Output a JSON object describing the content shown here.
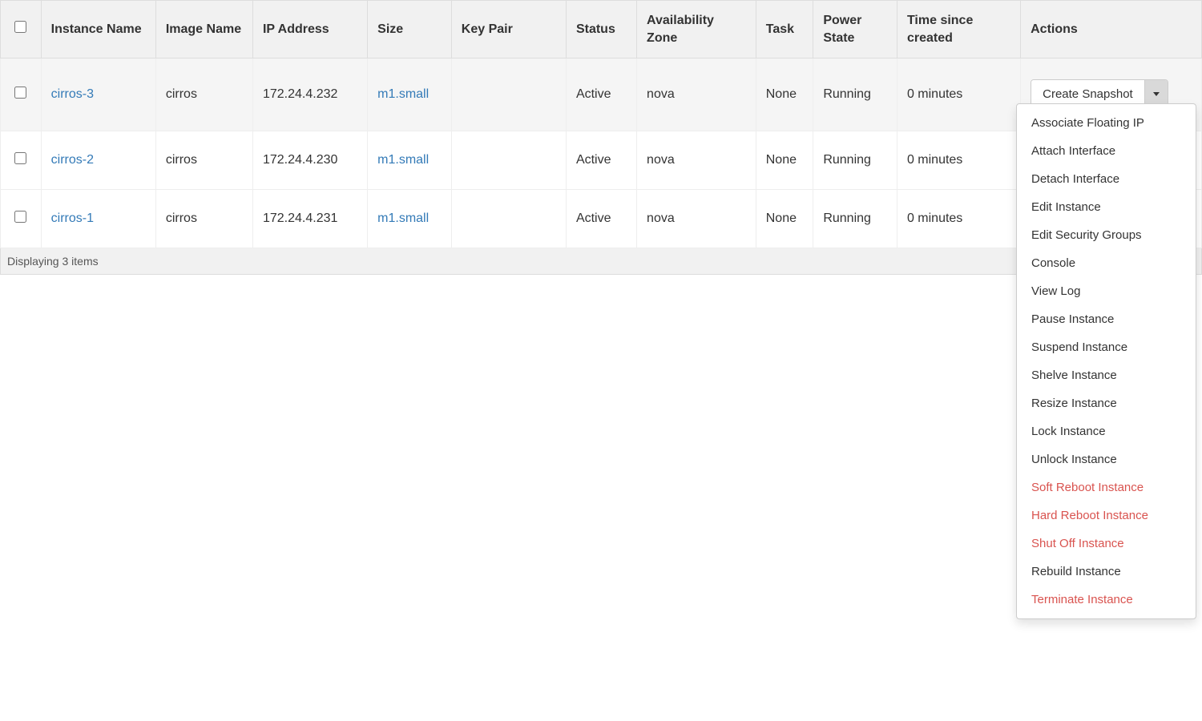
{
  "table": {
    "headers": {
      "instance_name": "Instance Name",
      "image_name": "Image Name",
      "ip_address": "IP Address",
      "size": "Size",
      "key_pair": "Key Pair",
      "status": "Status",
      "availability_zone": "Availability Zone",
      "task": "Task",
      "power_state": "Power State",
      "time_since_created": "Time since created",
      "actions": "Actions"
    },
    "rows": [
      {
        "instance_name": "cirros-3",
        "image_name": "cirros",
        "ip_address": "172.24.4.232",
        "size": "m1.small",
        "key_pair": "",
        "status": "Active",
        "availability_zone": "nova",
        "task": "None",
        "power_state": "Running",
        "time_since_created": "0 minutes",
        "action_label": "Create Snapshot",
        "dropdown_open": true
      },
      {
        "instance_name": "cirros-2",
        "image_name": "cirros",
        "ip_address": "172.24.4.230",
        "size": "m1.small",
        "key_pair": "",
        "status": "Active",
        "availability_zone": "nova",
        "task": "None",
        "power_state": "Running",
        "time_since_created": "0 minutes"
      },
      {
        "instance_name": "cirros-1",
        "image_name": "cirros",
        "ip_address": "172.24.4.231",
        "size": "m1.small",
        "key_pair": "",
        "status": "Active",
        "availability_zone": "nova",
        "task": "None",
        "power_state": "Running",
        "time_since_created": "0 minutes"
      }
    ]
  },
  "dropdown": {
    "items": [
      {
        "label": "Associate Floating IP",
        "danger": false
      },
      {
        "label": "Attach Interface",
        "danger": false
      },
      {
        "label": "Detach Interface",
        "danger": false
      },
      {
        "label": "Edit Instance",
        "danger": false
      },
      {
        "label": "Edit Security Groups",
        "danger": false
      },
      {
        "label": "Console",
        "danger": false
      },
      {
        "label": "View Log",
        "danger": false
      },
      {
        "label": "Pause Instance",
        "danger": false
      },
      {
        "label": "Suspend Instance",
        "danger": false
      },
      {
        "label": "Shelve Instance",
        "danger": false
      },
      {
        "label": "Resize Instance",
        "danger": false
      },
      {
        "label": "Lock Instance",
        "danger": false
      },
      {
        "label": "Unlock Instance",
        "danger": false
      },
      {
        "label": "Soft Reboot Instance",
        "danger": true
      },
      {
        "label": "Hard Reboot Instance",
        "danger": true
      },
      {
        "label": "Shut Off Instance",
        "danger": true
      },
      {
        "label": "Rebuild Instance",
        "danger": false
      },
      {
        "label": "Terminate Instance",
        "danger": true
      }
    ]
  },
  "footer": {
    "displaying": "Displaying 3 items"
  }
}
